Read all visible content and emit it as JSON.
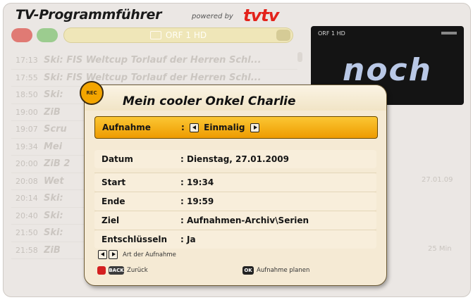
{
  "header": {
    "app_title": "TV-Programmführer",
    "powered_by": "powered by",
    "brand": "tvtv"
  },
  "channel_bar": {
    "label": "ORF 1 HD"
  },
  "programme_list": [
    {
      "time": "17:13",
      "title": "Ski: FIS Weltcup Torlauf der Herren Schl..."
    },
    {
      "time": "17:55",
      "title": "Ski: FIS Weltcup Torlauf der Herren Schl..."
    },
    {
      "time": "18:50",
      "title": "Ski:"
    },
    {
      "time": "19:00",
      "title": "ZiB"
    },
    {
      "time": "19:07",
      "title": "Scru"
    },
    {
      "time": "19:34",
      "title": "Mei"
    },
    {
      "time": "20:00",
      "title": "ZiB 2"
    },
    {
      "time": "20:08",
      "title": "Wet"
    },
    {
      "time": "20:14",
      "title": "Ski:"
    },
    {
      "time": "20:40",
      "title": "Ski:"
    },
    {
      "time": "21:50",
      "title": "Ski:"
    },
    {
      "time": "21:58",
      "title": "ZiB"
    }
  ],
  "preview": {
    "channel": "ORF 1 HD",
    "overlay_text": "noch"
  },
  "side_info": {
    "date": "27.01.09",
    "duration": "25 Min"
  },
  "dialog": {
    "badge": "REC",
    "title": "Mein cooler Onkel Charlie",
    "fields": {
      "recording": {
        "label": "Aufnahme",
        "value": "Einmalig"
      },
      "date": {
        "label": "Datum",
        "value": ": Dienstag, 27.01.2009"
      },
      "start": {
        "label": "Start",
        "value": ": 19:34"
      },
      "end": {
        "label": "Ende",
        "value": ": 19:59"
      },
      "target": {
        "label": "Ziel",
        "value": ": Aufnahmen-Archiv\\Serien"
      },
      "decrypt": {
        "label": "Entschlüsseln",
        "value": ": Ja"
      }
    },
    "footer": {
      "nav_hint": "Art der Aufnahme",
      "back_key": "BACK",
      "back_label": "Zurück",
      "ok_key": "OK",
      "ok_label": "Aufnahme planen"
    }
  },
  "colors": {
    "highlight": "#f3a500",
    "dialog_bg": "#f5ead4",
    "brand_red": "#e3231b"
  }
}
